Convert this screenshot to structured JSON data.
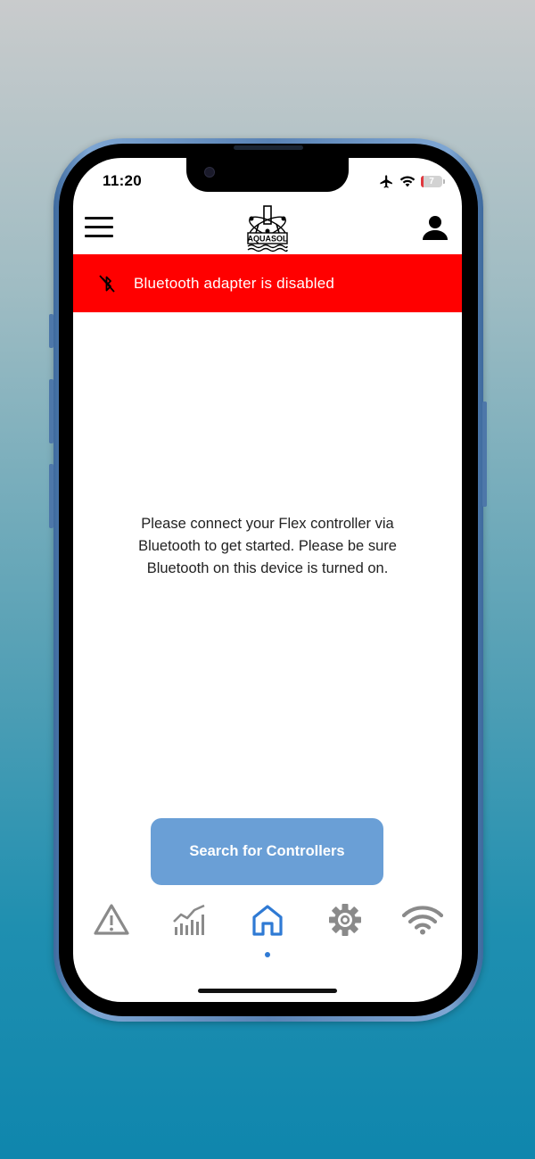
{
  "status_bar": {
    "time": "11:20",
    "battery_level": "7",
    "icons": [
      "airplane-icon",
      "wifi-icon",
      "battery-icon"
    ]
  },
  "header": {
    "logo_text": "AQUASOL",
    "menu_icon": "hamburger-menu-icon",
    "profile_icon": "user-icon"
  },
  "alert": {
    "text": "Bluetooth adapter is disabled",
    "icon": "bluetooth-disabled-icon",
    "color": "#ff0000"
  },
  "main": {
    "message": "Please connect your Flex controller via\nBluetooth to get started. Please be sure\nBluetooth on this device is turned on."
  },
  "actions": {
    "search_label": "Search for Controllers",
    "button_color": "#6a9fd6"
  },
  "nav": {
    "items": [
      {
        "icon": "alert-triangle-icon",
        "active": false
      },
      {
        "icon": "chart-icon",
        "active": false
      },
      {
        "icon": "home-icon",
        "active": true
      },
      {
        "icon": "gear-icon",
        "active": false
      },
      {
        "icon": "wifi-icon",
        "active": false
      }
    ],
    "active_color": "#2f7ad4",
    "inactive_color": "#8a8a8a"
  }
}
